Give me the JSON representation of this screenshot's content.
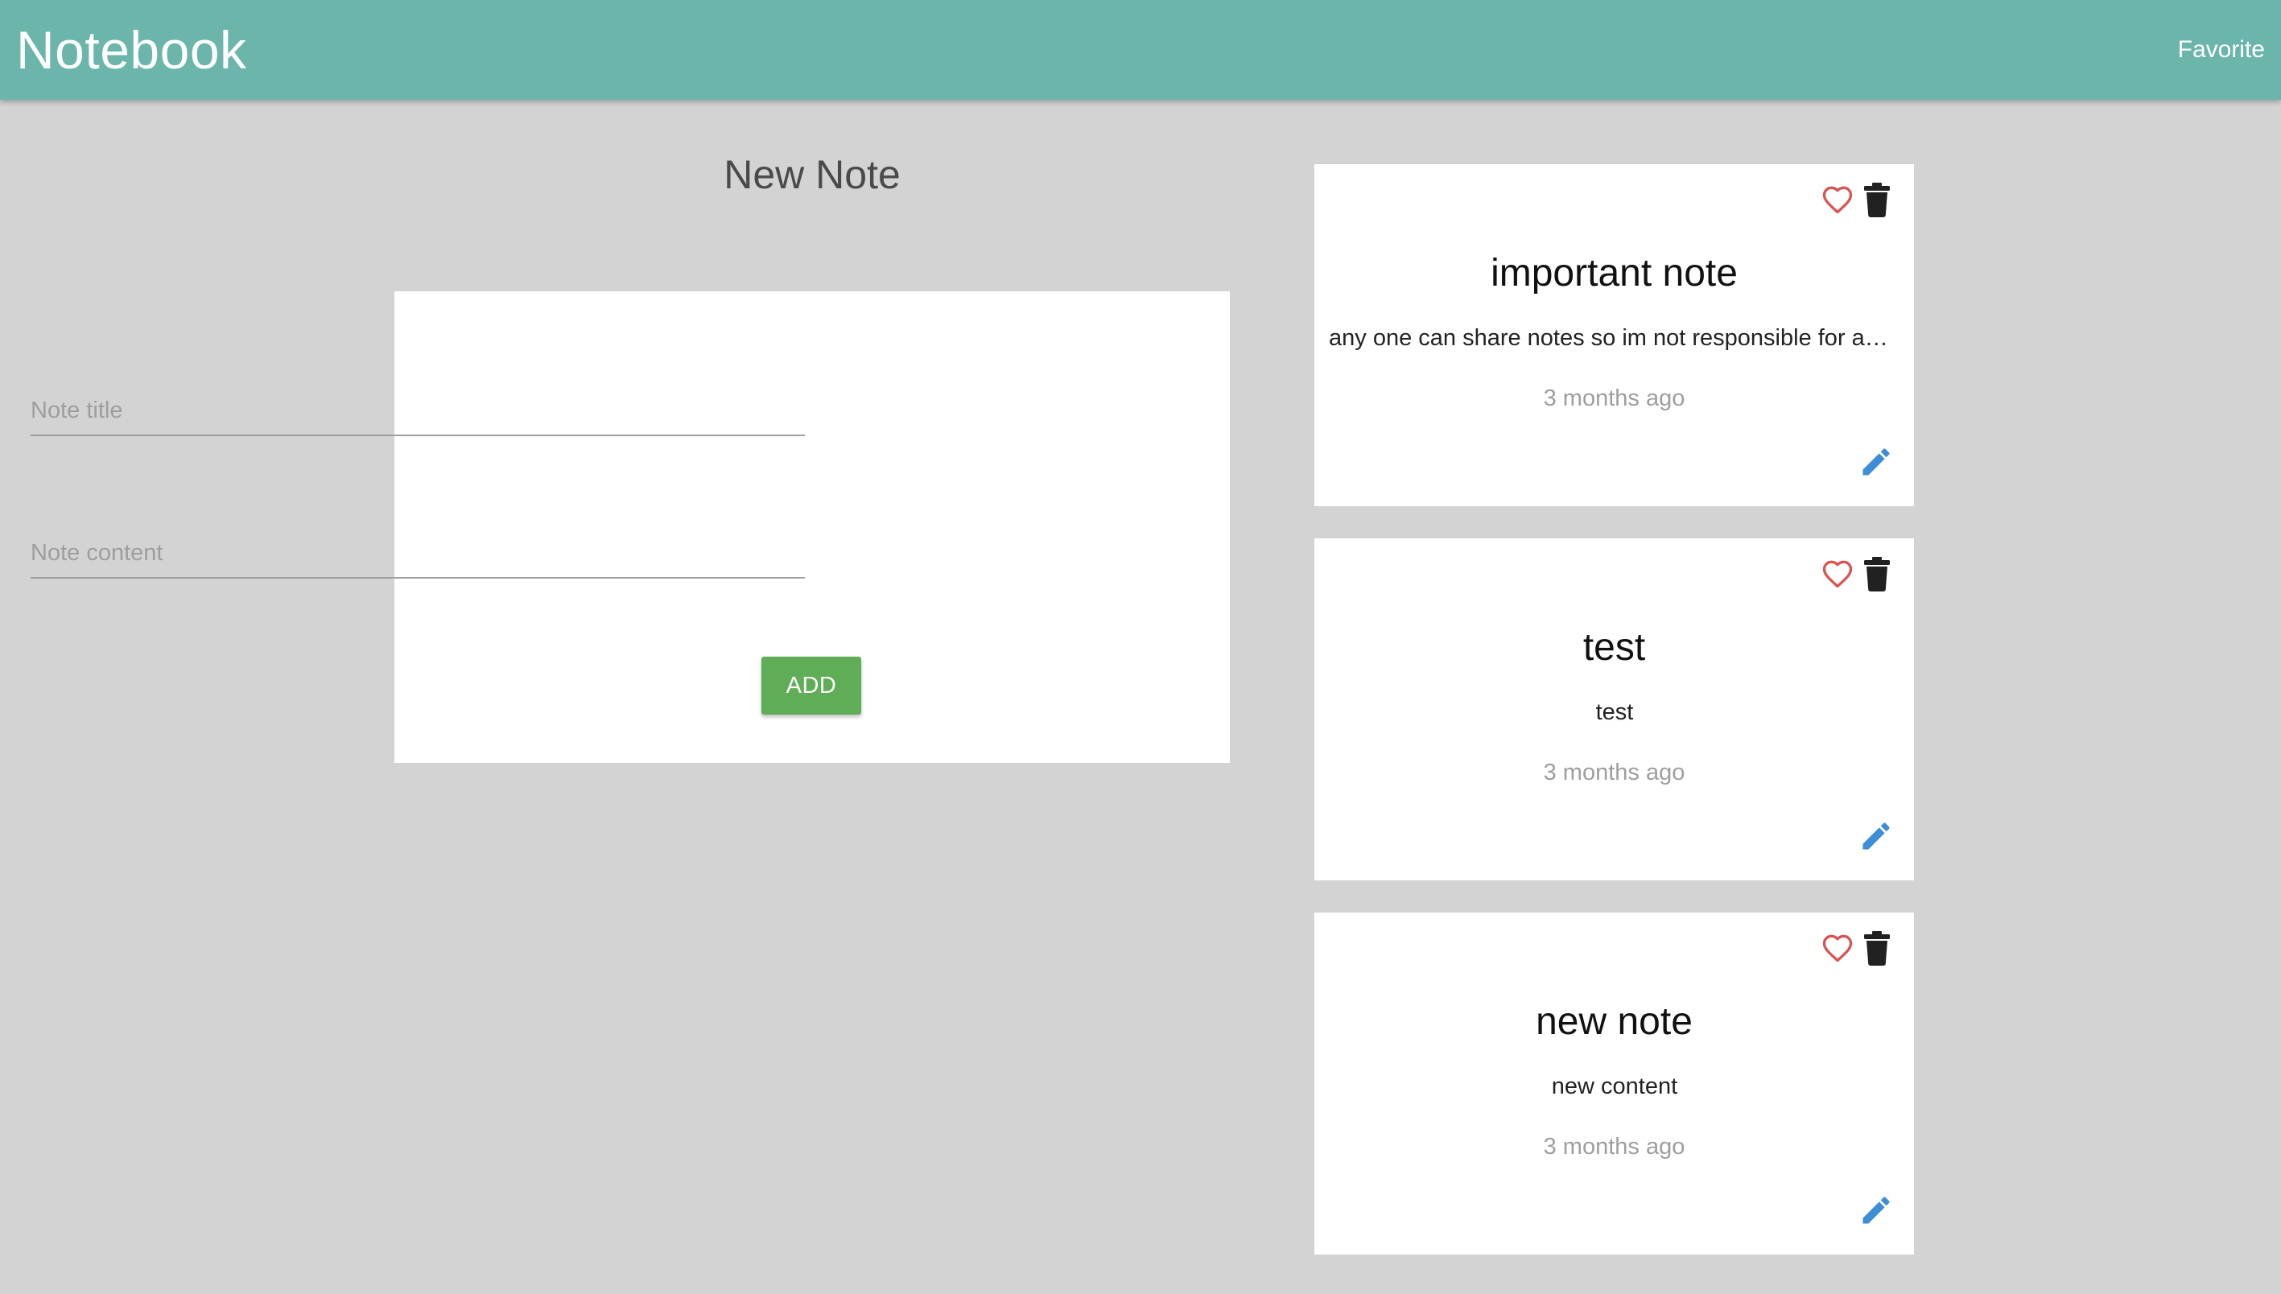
{
  "navbar": {
    "brand": "Notebook",
    "favorite_link": "Favorite"
  },
  "form": {
    "heading": "New Note",
    "title_placeholder": "Note title",
    "title_value": "",
    "content_placeholder": "Note content",
    "content_value": "",
    "add_label": "ADD"
  },
  "notes": [
    {
      "title": "important note",
      "content": "any one can share notes so im not responsible for any notes posted here",
      "time": "3 months ago"
    },
    {
      "title": "test",
      "content": "test",
      "time": "3 months ago"
    },
    {
      "title": "new note",
      "content": "new content",
      "time": "3 months ago"
    }
  ],
  "icons": {
    "favorite": "heart-outline-icon",
    "delete": "trash-icon",
    "edit": "pencil-icon"
  },
  "colors": {
    "navbar": "#6bb5ab",
    "background": "#d3d3d3",
    "add_button": "#5fad56",
    "heart": "#d9534f",
    "edit": "#3d8ed6",
    "trash": "#212121"
  }
}
